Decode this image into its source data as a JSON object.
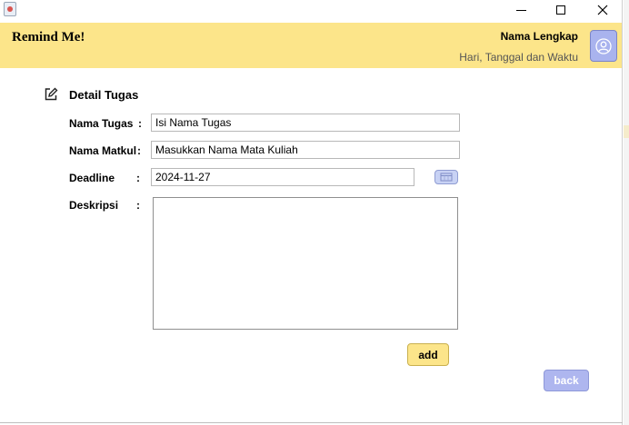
{
  "window": {
    "app_icon": "java-icon",
    "controls": [
      "minimize-icon",
      "maximize-icon",
      "close-icon"
    ]
  },
  "header": {
    "app_title": "Remind Me!",
    "user_name": "Nama Lengkap",
    "date_time": "Hari, Tanggal dan Waktu",
    "avatar_icon": "user-circle-icon",
    "background": "#fce58a"
  },
  "form": {
    "section_icon": "edit-icon",
    "section_title": "Detail Tugas",
    "fields": {
      "nama_tugas": {
        "label": "Nama Tugas",
        "colon": ":",
        "value": "Isi Nama Tugas"
      },
      "nama_matkul": {
        "label": "Nama Matkul",
        "colon": ":",
        "value": "Masukkan Nama Mata Kuliah"
      },
      "deadline": {
        "label": "Deadline",
        "colon": ":",
        "value": "2024-11-27",
        "calendar_icon": "calendar-icon"
      },
      "deskripsi": {
        "label": "Deskripsi",
        "colon": ":",
        "value": ""
      }
    },
    "add_label": "add",
    "back_label": "back"
  },
  "colors": {
    "accent_yellow": "#fce58a",
    "accent_blue": "#aeb6ef"
  }
}
